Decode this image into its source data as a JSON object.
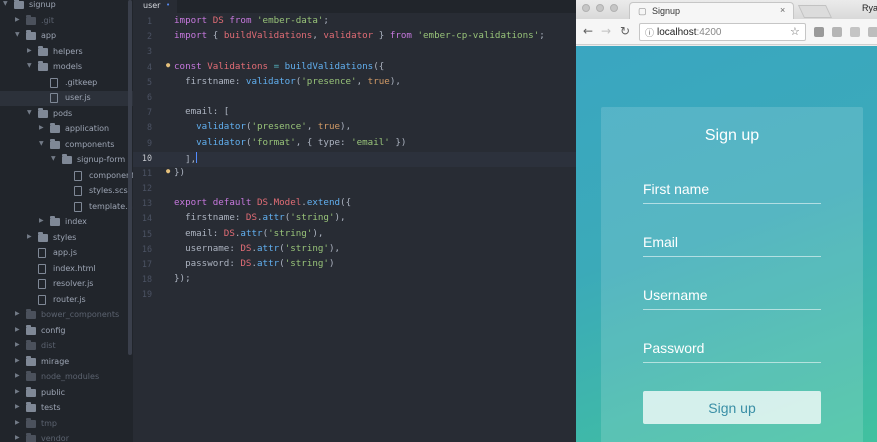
{
  "sidebar": {
    "items": [
      {
        "label": "signup",
        "kind": "folder",
        "expanded": true,
        "dim": false,
        "selected": false
      },
      {
        "label": ".git",
        "kind": "folder",
        "expanded": false,
        "dim": true,
        "selected": false
      },
      {
        "label": "app",
        "kind": "folder",
        "expanded": true,
        "dim": false,
        "selected": false
      },
      {
        "label": "helpers",
        "kind": "folder",
        "expanded": false,
        "dim": false,
        "selected": false
      },
      {
        "label": "models",
        "kind": "folder",
        "expanded": true,
        "dim": false,
        "selected": false
      },
      {
        "label": ".gitkeep",
        "kind": "file",
        "dim": false,
        "selected": false
      },
      {
        "label": "user.js",
        "kind": "file",
        "dim": false,
        "selected": true
      },
      {
        "label": "pods",
        "kind": "folder",
        "expanded": true,
        "dim": false,
        "selected": false
      },
      {
        "label": "application",
        "kind": "folder",
        "expanded": false,
        "dim": false,
        "selected": false
      },
      {
        "label": "components",
        "kind": "folder",
        "expanded": true,
        "dim": false,
        "selected": false
      },
      {
        "label": "signup-form",
        "kind": "folder",
        "expanded": true,
        "dim": false,
        "selected": false
      },
      {
        "label": "component.",
        "kind": "file",
        "dim": false,
        "selected": false
      },
      {
        "label": "styles.scss",
        "kind": "file",
        "dim": false,
        "selected": false
      },
      {
        "label": "template.hb",
        "kind": "file",
        "dim": false,
        "selected": false
      },
      {
        "label": "index",
        "kind": "folder",
        "expanded": false,
        "dim": false,
        "selected": false
      },
      {
        "label": "styles",
        "kind": "folder",
        "expanded": false,
        "dim": false,
        "selected": false
      },
      {
        "label": "app.js",
        "kind": "file",
        "dim": false,
        "selected": false
      },
      {
        "label": "index.html",
        "kind": "file",
        "dim": false,
        "selected": false
      },
      {
        "label": "resolver.js",
        "kind": "file",
        "dim": false,
        "selected": false
      },
      {
        "label": "router.js",
        "kind": "file",
        "dim": false,
        "selected": false
      },
      {
        "label": "bower_components",
        "kind": "folder",
        "expanded": false,
        "dim": true,
        "selected": false
      },
      {
        "label": "config",
        "kind": "folder",
        "expanded": false,
        "dim": false,
        "selected": false
      },
      {
        "label": "dist",
        "kind": "folder",
        "expanded": false,
        "dim": true,
        "selected": false
      },
      {
        "label": "mirage",
        "kind": "folder",
        "expanded": false,
        "dim": false,
        "selected": false
      },
      {
        "label": "node_modules",
        "kind": "folder",
        "expanded": false,
        "dim": true,
        "selected": false
      },
      {
        "label": "public",
        "kind": "folder",
        "expanded": false,
        "dim": false,
        "selected": false
      },
      {
        "label": "tests",
        "kind": "folder",
        "expanded": false,
        "dim": false,
        "selected": false
      },
      {
        "label": "tmp",
        "kind": "folder",
        "expanded": false,
        "dim": true,
        "selected": false
      },
      {
        "label": "vendor",
        "kind": "folder",
        "expanded": false,
        "dim": true,
        "selected": false
      }
    ]
  },
  "editor": {
    "tab": {
      "label": "user",
      "modified_marker": "•"
    },
    "current_line": 10,
    "lines": [
      {
        "n": "1",
        "tokens": [
          [
            "k",
            "import "
          ],
          [
            "v",
            "DS "
          ],
          [
            "k",
            "from "
          ],
          [
            "s",
            "'ember-data'"
          ],
          [
            "p",
            ";"
          ]
        ]
      },
      {
        "n": "2",
        "tokens": [
          [
            "k",
            "import "
          ],
          [
            "p",
            "{ "
          ],
          [
            "v",
            "buildValidations"
          ],
          [
            "p",
            ", "
          ],
          [
            "v",
            "validator "
          ],
          [
            "p",
            "} "
          ],
          [
            "k",
            "from "
          ],
          [
            "s",
            "'ember-cp-validations'"
          ],
          [
            "p",
            ";"
          ]
        ]
      },
      {
        "n": "3",
        "tokens": []
      },
      {
        "n": "4",
        "dot": "●",
        "tokens": [
          [
            "k",
            "const "
          ],
          [
            "v",
            "Validations "
          ],
          [
            "o",
            "= "
          ],
          [
            "f",
            "buildValidations"
          ],
          [
            "p",
            "({"
          ]
        ]
      },
      {
        "n": "5",
        "tokens": [
          [
            "p",
            "  firstname: "
          ],
          [
            "f",
            "validator"
          ],
          [
            "p",
            "("
          ],
          [
            "s",
            "'presence'"
          ],
          [
            "p",
            ", "
          ],
          [
            "n",
            "true"
          ],
          [
            "p",
            "),"
          ]
        ]
      },
      {
        "n": "6",
        "tokens": []
      },
      {
        "n": "7",
        "tokens": [
          [
            "p",
            "  email: ["
          ]
        ]
      },
      {
        "n": "8",
        "tokens": [
          [
            "p",
            "    "
          ],
          [
            "f",
            "validator"
          ],
          [
            "p",
            "("
          ],
          [
            "s",
            "'presence'"
          ],
          [
            "p",
            ", "
          ],
          [
            "n",
            "true"
          ],
          [
            "p",
            "),"
          ]
        ]
      },
      {
        "n": "9",
        "tokens": [
          [
            "p",
            "    "
          ],
          [
            "f",
            "validator"
          ],
          [
            "p",
            "("
          ],
          [
            "s",
            "'format'"
          ],
          [
            "p",
            ", { type: "
          ],
          [
            "s",
            "'email'"
          ],
          [
            "p",
            " })"
          ]
        ]
      },
      {
        "n": "10",
        "cursor": true,
        "tokens": [
          [
            "p",
            "  ],"
          ]
        ]
      },
      {
        "n": "11",
        "dot": "●",
        "tokens": [
          [
            "p",
            "})"
          ]
        ]
      },
      {
        "n": "12",
        "tokens": []
      },
      {
        "n": "13",
        "tokens": [
          [
            "k",
            "export default "
          ],
          [
            "v",
            "DS"
          ],
          [
            "p",
            "."
          ],
          [
            "v",
            "Model"
          ],
          [
            "p",
            "."
          ],
          [
            "f",
            "extend"
          ],
          [
            "p",
            "({"
          ]
        ]
      },
      {
        "n": "14",
        "tokens": [
          [
            "p",
            "  firstname: "
          ],
          [
            "v",
            "DS"
          ],
          [
            "p",
            "."
          ],
          [
            "f",
            "attr"
          ],
          [
            "p",
            "("
          ],
          [
            "s",
            "'string'"
          ],
          [
            "p",
            "),"
          ]
        ]
      },
      {
        "n": "15",
        "tokens": [
          [
            "p",
            "  email: "
          ],
          [
            "v",
            "DS"
          ],
          [
            "p",
            "."
          ],
          [
            "f",
            "attr"
          ],
          [
            "p",
            "("
          ],
          [
            "s",
            "'string'"
          ],
          [
            "p",
            "),"
          ]
        ]
      },
      {
        "n": "16",
        "tokens": [
          [
            "p",
            "  username: "
          ],
          [
            "v",
            "DS"
          ],
          [
            "p",
            "."
          ],
          [
            "f",
            "attr"
          ],
          [
            "p",
            "("
          ],
          [
            "s",
            "'string'"
          ],
          [
            "p",
            "),"
          ]
        ]
      },
      {
        "n": "17",
        "tokens": [
          [
            "p",
            "  password: "
          ],
          [
            "v",
            "DS"
          ],
          [
            "p",
            "."
          ],
          [
            "f",
            "attr"
          ],
          [
            "p",
            "("
          ],
          [
            "s",
            "'string'"
          ],
          [
            "p",
            ")"
          ]
        ]
      },
      {
        "n": "18",
        "tokens": [
          [
            "p",
            "});"
          ]
        ]
      },
      {
        "n": "19",
        "tokens": []
      }
    ]
  },
  "browser": {
    "tab_title": "Signup",
    "tab_close": "×",
    "profile_name": "Rya",
    "address": {
      "host": "localhost",
      "port": ":4200"
    },
    "nav": {
      "back": "←",
      "forward": "→",
      "reload": "↻",
      "star": "☆",
      "page_icon": "ⓘ"
    },
    "form": {
      "title": "Sign up",
      "fields": [
        {
          "name": "first-name-field",
          "placeholder": "First name"
        },
        {
          "name": "email-field",
          "placeholder": "Email"
        },
        {
          "name": "username-field",
          "placeholder": "Username"
        },
        {
          "name": "password-field",
          "placeholder": "Password"
        }
      ],
      "submit_label": "Sign up"
    }
  }
}
